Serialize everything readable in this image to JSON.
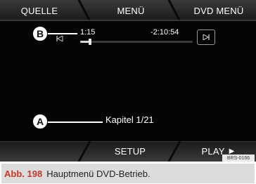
{
  "topbar": {
    "left_label": "QUELLE",
    "center_label": "MENÜ",
    "right_label": "DVD MENÜ"
  },
  "playback": {
    "elapsed": "1:15",
    "remaining": "-2:10:54",
    "progress_fraction": 0.09
  },
  "callouts": {
    "b": "B",
    "a": "A"
  },
  "status": {
    "chapter": "Kapitel 1/21"
  },
  "bottombar": {
    "setup_label": "SETUP",
    "play_label": "PLAY"
  },
  "image_code": "BRS-0166",
  "caption": {
    "prefix": "Abb. 198",
    "text": "Hauptmenü DVD-Betrieb."
  },
  "colors": {
    "screen_bg": "#050505",
    "bar_bg": "#2a2a2a",
    "text": "#ffffff",
    "caption_accent": "#c0392b"
  },
  "icons": {
    "prev": "skip-back-icon",
    "next": "skip-forward-icon",
    "play": "play-arrow-icon"
  }
}
